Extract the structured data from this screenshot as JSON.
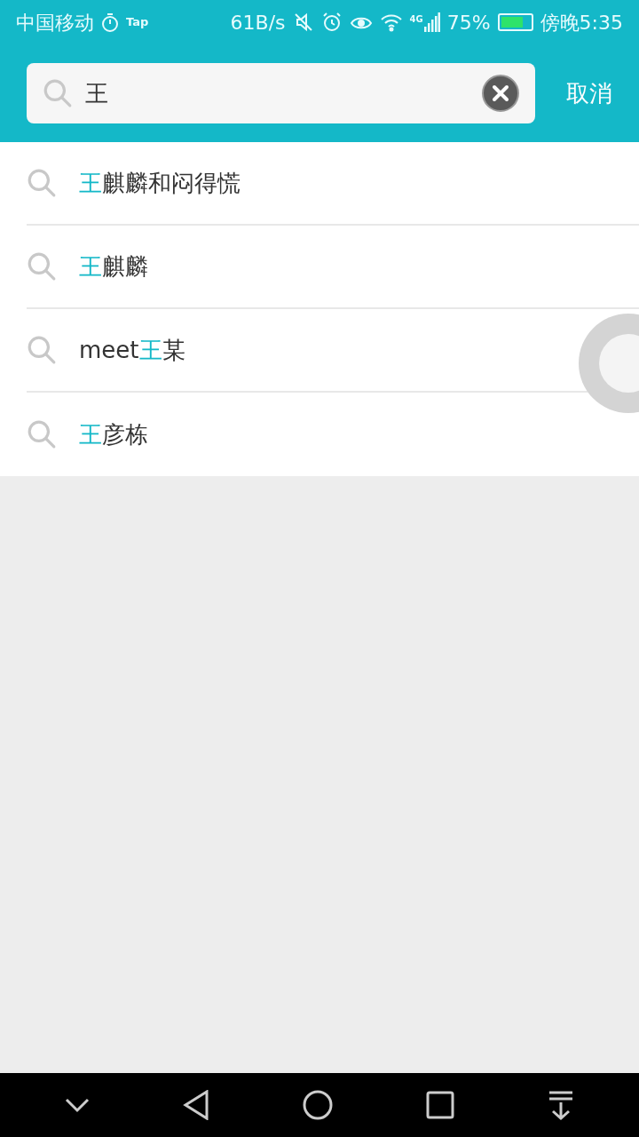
{
  "status_bar": {
    "carrier": "中国移动",
    "app_badge": "Tap",
    "speed": "61B/s",
    "network": "4G",
    "battery": "75%",
    "time": "傍晚5:35"
  },
  "search": {
    "value": "王",
    "cancel": "取消"
  },
  "suggestions": [
    {
      "parts": [
        {
          "text": "王",
          "highlight": true
        },
        {
          "text": "麒麟和闷得慌",
          "highlight": false
        }
      ]
    },
    {
      "parts": [
        {
          "text": "王",
          "highlight": true
        },
        {
          "text": "麒麟",
          "highlight": false
        }
      ]
    },
    {
      "parts": [
        {
          "text": "meet",
          "highlight": false
        },
        {
          "text": "王",
          "highlight": true
        },
        {
          "text": "某",
          "highlight": false
        }
      ]
    },
    {
      "parts": [
        {
          "text": "王",
          "highlight": true
        },
        {
          "text": "彦栋",
          "highlight": false
        }
      ]
    }
  ]
}
